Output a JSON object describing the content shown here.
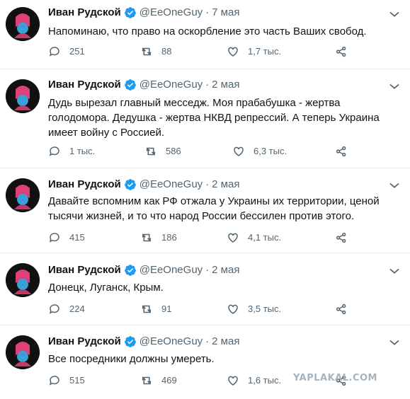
{
  "colors": {
    "verified": "#1d9bf0",
    "icon": "#536471",
    "divider": "#e6ecf0"
  },
  "tweets": [
    {
      "name": "Иван Рудской",
      "handle": "@EeOneGuy",
      "separator": "·",
      "date": "7 мая",
      "text": "Напоминаю, что право на оскорбление это часть Ваших свобод.",
      "replies": "251",
      "retweets": "88",
      "likes": "1,7 тыс."
    },
    {
      "name": "Иван Рудской",
      "handle": "@EeOneGuy",
      "separator": "·",
      "date": "2 мая",
      "text": "Дудь вырезал главный месседж. Моя прабабушка - жертва голодомора. Дедушка - жертва НКВД репрессий. А теперь Украина имеет войну с Россией.",
      "replies": "1 тыс.",
      "retweets": "586",
      "likes": "6,3 тыс."
    },
    {
      "name": "Иван Рудской",
      "handle": "@EeOneGuy",
      "separator": "·",
      "date": "2 мая",
      "text": "Давайте вспомним как РФ отжала у Украины их территории, ценой тысячи жизней, и то что народ России бессилен против этого.",
      "replies": "415",
      "retweets": "186",
      "likes": "4,1 тыс."
    },
    {
      "name": "Иван Рудской",
      "handle": "@EeOneGuy",
      "separator": "·",
      "date": "2 мая",
      "text": "Донецк, Луганск, Крым.",
      "replies": "224",
      "retweets": "91",
      "likes": "3,5 тыс."
    },
    {
      "name": "Иван Рудской",
      "handle": "@EeOneGuy",
      "separator": "·",
      "date": "2 мая",
      "text": "Все посредники должны умереть.",
      "replies": "515",
      "retweets": "469",
      "likes": "1,6 тыс."
    }
  ],
  "watermark": "YAPLAKAL.COM"
}
